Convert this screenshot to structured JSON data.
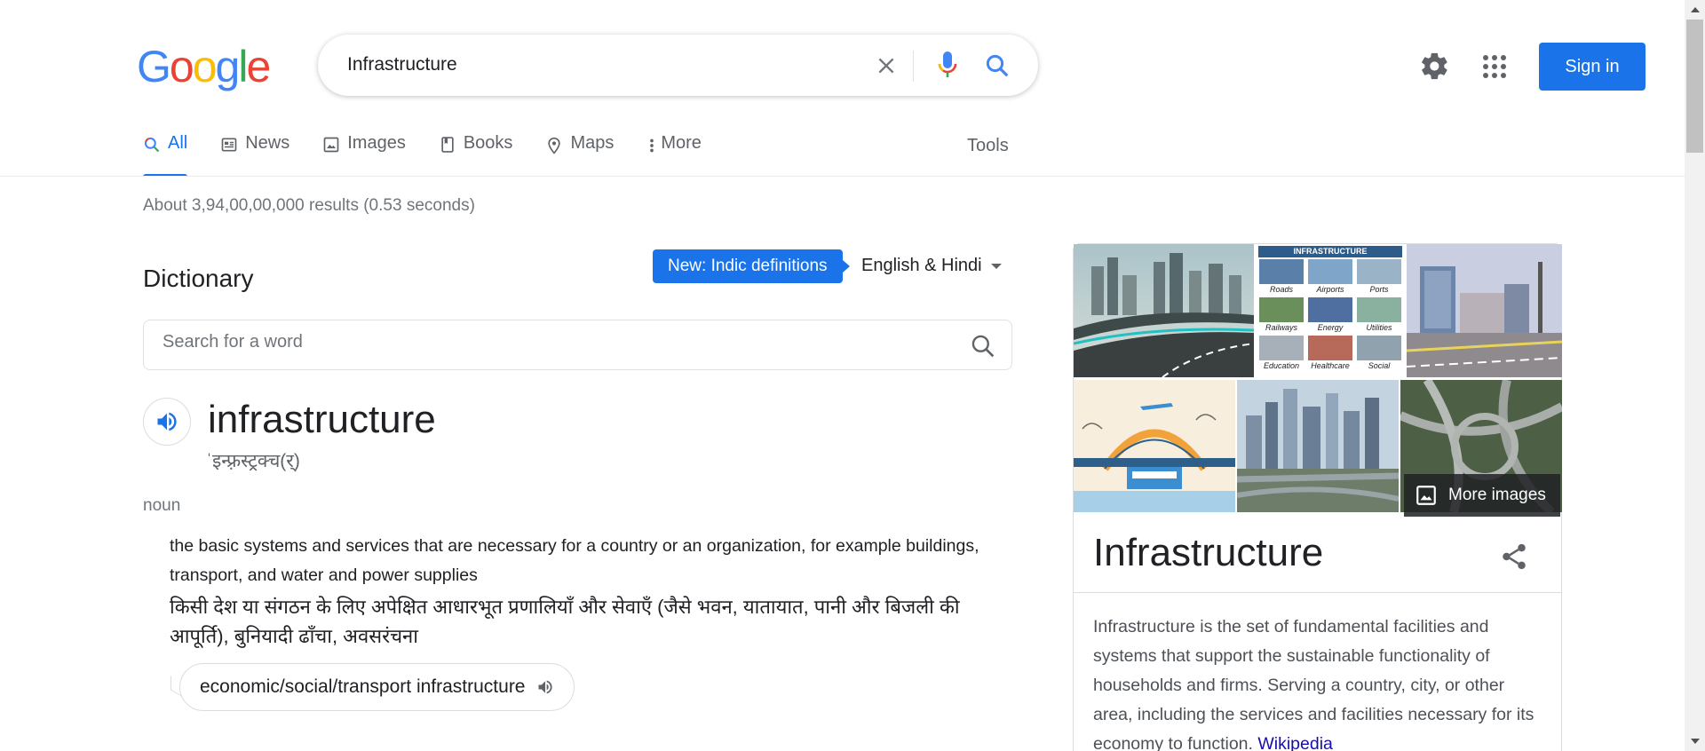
{
  "logo": {
    "letters": [
      "G",
      "o",
      "o",
      "g",
      "l",
      "e"
    ],
    "colors": [
      "#4285F4",
      "#EA4335",
      "#FBBC05",
      "#4285F4",
      "#34A853",
      "#EA4335"
    ]
  },
  "search": {
    "query": "Infrastructure"
  },
  "header": {
    "sign_in": "Sign in",
    "settings_icon": "gear-icon",
    "apps_icon": "apps-grid-icon"
  },
  "tabs": [
    {
      "label": "All",
      "icon": "search-icon",
      "active": true
    },
    {
      "label": "News",
      "icon": "news-icon"
    },
    {
      "label": "Images",
      "icon": "image-icon"
    },
    {
      "label": "Books",
      "icon": "book-icon"
    },
    {
      "label": "Maps",
      "icon": "map-pin-icon"
    },
    {
      "label": "More",
      "icon": "more-vert-icon"
    }
  ],
  "tools_label": "Tools",
  "results_stats": "About 3,94,00,00,000 results (0.53 seconds)",
  "dictionary": {
    "title": "Dictionary",
    "indic_badge": "New: Indic definitions",
    "language": "English & Hindi",
    "search_placeholder": "Search for a word",
    "word": "infrastructure",
    "phonetic": "ˈइन्फ़्रस्ट्रक्च(र्)",
    "part_of_speech": "noun",
    "definition_en": "the basic systems and services that are necessary for a country or an organization, for example buildings, transport, and water and power supplies",
    "definition_hi": "किसी देश या संगठन के लिए अपेक्षित आधारभूत प्रणालियाँ और सेवाएँ (जैसे भवन, यातायात, पानी और बिजली की आपूर्ति), बुनियादी ढाँचा, अवसरंचना",
    "example": "economic/social/transport infrastructure"
  },
  "knowledge_panel": {
    "more_images": "More images",
    "title": "Infrastructure",
    "description": "Infrastructure is the set of fundamental facilities and systems that support the sustainable functionality of households and firms. Serving a country, city, or other area, including the services and facilities necessary for its economy to function.",
    "source_link": "Wikipedia",
    "collage": {
      "header": "INFRASTRUCTURE",
      "labels": [
        "Roads",
        "Airports",
        "Ports",
        "Railways",
        "Energy",
        "Utilities",
        "Education",
        "Healthcare",
        "Social"
      ]
    }
  },
  "colors": {
    "accent": "#1a73e8",
    "link": "#1a0dab",
    "muted": "#70757a"
  }
}
